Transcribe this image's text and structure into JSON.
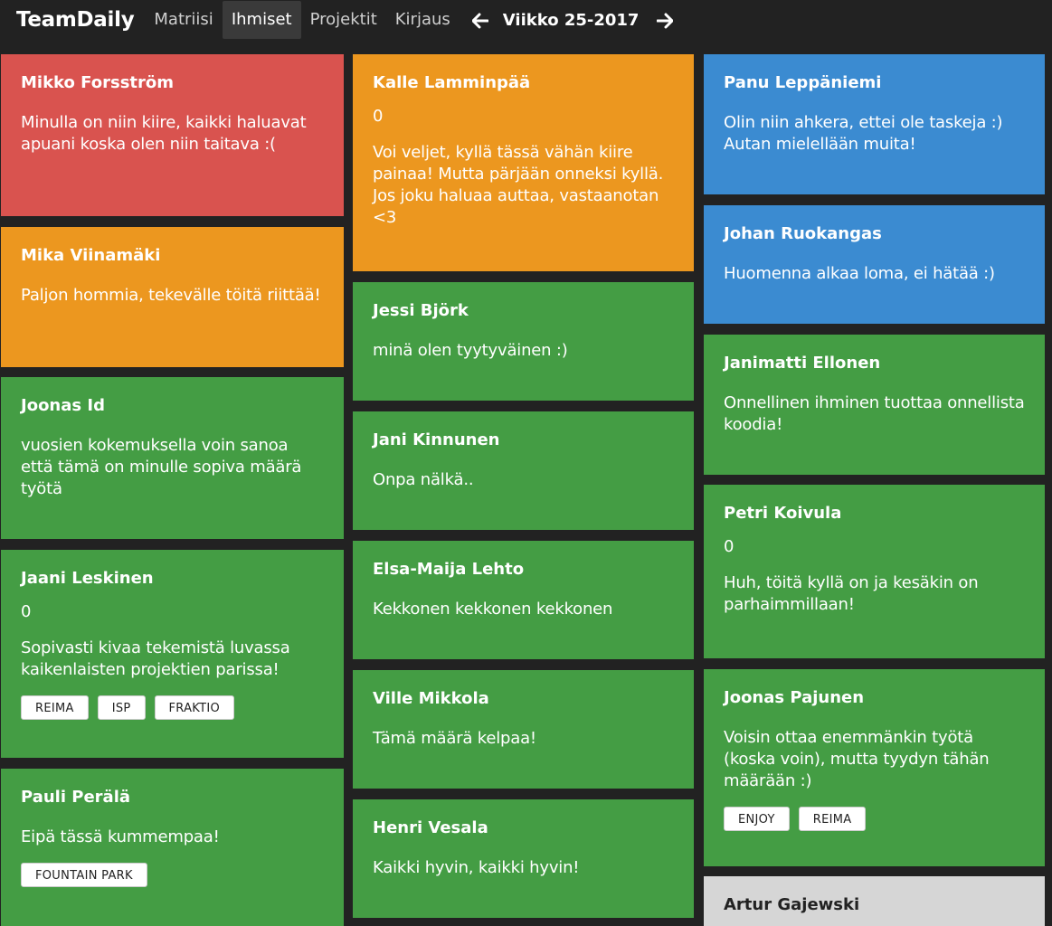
{
  "nav": {
    "brand": "TeamDaily",
    "links": [
      "Matriisi",
      "Ihmiset",
      "Projektit",
      "Kirjaus"
    ],
    "active": "Ihmiset",
    "week": "Viikko 25-2017",
    "prev_icon": "arrow-left-icon",
    "next_icon": "arrow-right-icon"
  },
  "colors": {
    "red": "#d9534f",
    "orange": "#ec971f",
    "green": "#449d44",
    "blue": "#3b8bd1",
    "gray": "#d6d6d6"
  },
  "people": [
    {
      "name": "Mikko Forsström",
      "status": "red",
      "message": "Minulla on niin kiire, kaikki haluavat apuani koska olen niin taitava :("
    },
    {
      "name": "Mika Viinamäki",
      "status": "orange",
      "message": "Paljon hommia, tekevälle töitä riittää!"
    },
    {
      "name": "Joonas Id",
      "status": "green",
      "message": "vuosien kokemuksella voin sanoa että tämä on minulle sopiva määrä työtä"
    },
    {
      "name": "Jaani Leskinen",
      "status": "green",
      "score": "0",
      "message": "Sopivasti kivaa tekemistä luvassa kaikenlaisten projektien parissa!",
      "tags": [
        "REIMA",
        "ISP",
        "FRAKTIO"
      ]
    },
    {
      "name": "Pauli Perälä",
      "status": "green",
      "message": "Eipä tässä kummempaa!",
      "tags": [
        "FOUNTAIN PARK"
      ]
    },
    {
      "name": "Kalle Lamminpää",
      "status": "orange",
      "score": "0",
      "message": "Voi veljet, kyllä tässä vähän kiire painaa! Mutta pärjään onneksi kyllä. Jos joku haluaa auttaa, vastaanotan <3"
    },
    {
      "name": "Jessi Björk",
      "status": "green",
      "message": "minä olen tyytyväinen :)"
    },
    {
      "name": "Jani Kinnunen",
      "status": "green",
      "message": "Onpa nälkä.."
    },
    {
      "name": "Elsa-Maija Lehto",
      "status": "green",
      "message": "Kekkonen kekkonen kekkonen"
    },
    {
      "name": "Ville Mikkola",
      "status": "green",
      "message": "Tämä määrä kelpaa!"
    },
    {
      "name": "Henri Vesala",
      "status": "green",
      "message": "Kaikki hyvin, kaikki hyvin!"
    },
    {
      "name": "Panu Leppäniemi",
      "status": "blue",
      "message": "Olin niin ahkera, ettei ole taskeja :) Autan mielellään muita!"
    },
    {
      "name": "Johan Ruokangas",
      "status": "blue",
      "message": "Huomenna alkaa loma, ei hätää :)"
    },
    {
      "name": "Janimatti Ellonen",
      "status": "green",
      "message": "Onnellinen ihminen tuottaa onnellista koodia!"
    },
    {
      "name": "Petri Koivula",
      "status": "green",
      "score": "0",
      "message": "Huh, töitä kyllä on ja kesäkin on parhaimmillaan!"
    },
    {
      "name": "Joonas Pajunen",
      "status": "green",
      "message": "Voisin ottaa enemmänkin työtä (koska voin), mutta tyydyn tähän määrään :)",
      "tags": [
        "ENJOY",
        "REIMA"
      ]
    },
    {
      "name": "Artur Gajewski",
      "status": "gray"
    }
  ]
}
